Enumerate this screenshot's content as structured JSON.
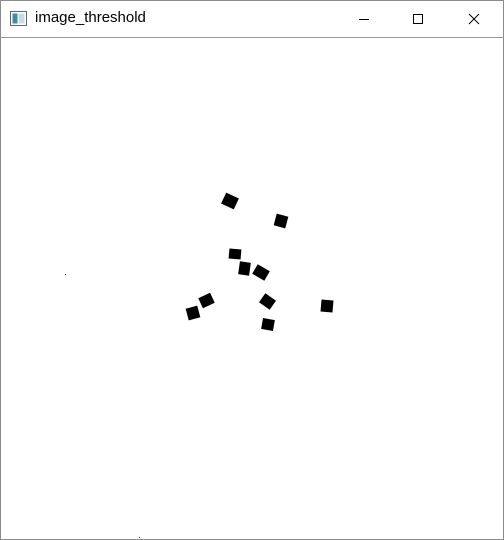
{
  "window": {
    "title": "image_threshold",
    "icons": {
      "app": "app-window-icon",
      "minimize": "minimize-icon",
      "maximize": "maximize-icon",
      "close": "close-icon"
    }
  },
  "image": {
    "description_colors": {
      "background": "#ffffff",
      "blobs": "#000000"
    },
    "blob_count": 11
  }
}
